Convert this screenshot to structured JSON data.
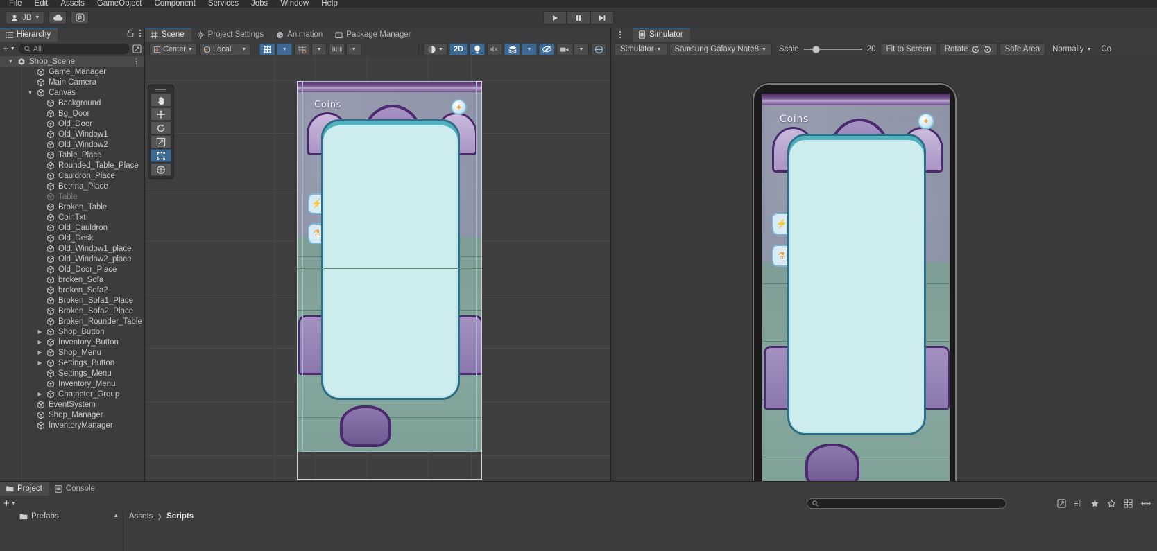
{
  "menubar": {
    "items": [
      "File",
      "Edit",
      "Assets",
      "GameObject",
      "Component",
      "Services",
      "Jobs",
      "Window",
      "Help"
    ]
  },
  "toolbar": {
    "account_label": "JB",
    "cloud_icon": "cloud-icon",
    "collab_icon": "collab-icon",
    "play_icon": "play-icon",
    "pause_icon": "pause-icon",
    "step_icon": "step-icon"
  },
  "hierarchy": {
    "tab_label": "Hierarchy",
    "lock_icon": "lock-icon",
    "menu_icon": "kebab-menu-icon",
    "add_label": "+",
    "search_placeholder": "All",
    "search_icon": "search-icon",
    "filter_icon": "filter-icon",
    "items": [
      {
        "label": "Shop_Scene",
        "depth": 0,
        "arrow": "down",
        "icon": "unity-scene-icon",
        "selected": true,
        "dim": false,
        "kebab": true
      },
      {
        "label": "Game_Manager",
        "depth": 2,
        "arrow": "",
        "icon": "gameobject-icon",
        "selected": false,
        "dim": false,
        "kebab": false
      },
      {
        "label": "Main Camera",
        "depth": 2,
        "arrow": "",
        "icon": "gameobject-icon",
        "selected": false,
        "dim": false,
        "kebab": false
      },
      {
        "label": "Canvas",
        "depth": 2,
        "arrow": "down",
        "icon": "gameobject-icon",
        "selected": false,
        "dim": false,
        "kebab": false
      },
      {
        "label": "Background",
        "depth": 3,
        "arrow": "",
        "icon": "gameobject-icon",
        "selected": false,
        "dim": false,
        "kebab": false
      },
      {
        "label": "Bg_Door",
        "depth": 3,
        "arrow": "",
        "icon": "gameobject-icon",
        "selected": false,
        "dim": false,
        "kebab": false
      },
      {
        "label": "Old_Door",
        "depth": 3,
        "arrow": "",
        "icon": "gameobject-icon",
        "selected": false,
        "dim": false,
        "kebab": false
      },
      {
        "label": "Old_Window1",
        "depth": 3,
        "arrow": "",
        "icon": "gameobject-icon",
        "selected": false,
        "dim": false,
        "kebab": false
      },
      {
        "label": "Old_Window2",
        "depth": 3,
        "arrow": "",
        "icon": "gameobject-icon",
        "selected": false,
        "dim": false,
        "kebab": false
      },
      {
        "label": "Table_Place",
        "depth": 3,
        "arrow": "",
        "icon": "gameobject-icon",
        "selected": false,
        "dim": false,
        "kebab": false
      },
      {
        "label": "Rounded_Table_Place",
        "depth": 3,
        "arrow": "",
        "icon": "gameobject-icon",
        "selected": false,
        "dim": false,
        "kebab": false
      },
      {
        "label": "Cauldron_Place",
        "depth": 3,
        "arrow": "",
        "icon": "gameobject-icon",
        "selected": false,
        "dim": false,
        "kebab": false
      },
      {
        "label": "Betrina_Place",
        "depth": 3,
        "arrow": "",
        "icon": "gameobject-icon",
        "selected": false,
        "dim": false,
        "kebab": false
      },
      {
        "label": "Table",
        "depth": 3,
        "arrow": "",
        "icon": "gameobject-icon",
        "selected": false,
        "dim": true,
        "kebab": false
      },
      {
        "label": "Broken_Table",
        "depth": 3,
        "arrow": "",
        "icon": "gameobject-icon",
        "selected": false,
        "dim": false,
        "kebab": false
      },
      {
        "label": "CoinTxt",
        "depth": 3,
        "arrow": "",
        "icon": "gameobject-icon",
        "selected": false,
        "dim": false,
        "kebab": false
      },
      {
        "label": "Old_Cauldron",
        "depth": 3,
        "arrow": "",
        "icon": "gameobject-icon",
        "selected": false,
        "dim": false,
        "kebab": false
      },
      {
        "label": "Old_Desk",
        "depth": 3,
        "arrow": "",
        "icon": "gameobject-icon",
        "selected": false,
        "dim": false,
        "kebab": false
      },
      {
        "label": "Old_Window1_place",
        "depth": 3,
        "arrow": "",
        "icon": "gameobject-icon",
        "selected": false,
        "dim": false,
        "kebab": false
      },
      {
        "label": "Old_Window2_place",
        "depth": 3,
        "arrow": "",
        "icon": "gameobject-icon",
        "selected": false,
        "dim": false,
        "kebab": false
      },
      {
        "label": "Old_Door_Place",
        "depth": 3,
        "arrow": "",
        "icon": "gameobject-icon",
        "selected": false,
        "dim": false,
        "kebab": false
      },
      {
        "label": "broken_Sofa",
        "depth": 3,
        "arrow": "",
        "icon": "gameobject-icon",
        "selected": false,
        "dim": false,
        "kebab": false
      },
      {
        "label": "broken_Sofa2",
        "depth": 3,
        "arrow": "",
        "icon": "gameobject-icon",
        "selected": false,
        "dim": false,
        "kebab": false
      },
      {
        "label": "Broken_Sofa1_Place",
        "depth": 3,
        "arrow": "",
        "icon": "gameobject-icon",
        "selected": false,
        "dim": false,
        "kebab": false
      },
      {
        "label": "Broken_Sofa2_Place",
        "depth": 3,
        "arrow": "",
        "icon": "gameobject-icon",
        "selected": false,
        "dim": false,
        "kebab": false
      },
      {
        "label": "Broken_Rounder_Table",
        "depth": 3,
        "arrow": "",
        "icon": "gameobject-icon",
        "selected": false,
        "dim": false,
        "kebab": false
      },
      {
        "label": "Shop_Button",
        "depth": 3,
        "arrow": "right",
        "icon": "gameobject-icon",
        "selected": false,
        "dim": false,
        "kebab": false
      },
      {
        "label": "Inventory_Button",
        "depth": 3,
        "arrow": "right",
        "icon": "gameobject-icon",
        "selected": false,
        "dim": false,
        "kebab": false
      },
      {
        "label": "Shop_Menu",
        "depth": 3,
        "arrow": "right",
        "icon": "gameobject-icon",
        "selected": false,
        "dim": false,
        "kebab": false
      },
      {
        "label": "Settings_Button",
        "depth": 3,
        "arrow": "right",
        "icon": "gameobject-icon",
        "selected": false,
        "dim": false,
        "kebab": false
      },
      {
        "label": "Settings_Menu",
        "depth": 3,
        "arrow": "",
        "icon": "gameobject-icon",
        "selected": false,
        "dim": false,
        "kebab": false
      },
      {
        "label": "Inventory_Menu",
        "depth": 3,
        "arrow": "",
        "icon": "gameobject-icon",
        "selected": false,
        "dim": false,
        "kebab": false
      },
      {
        "label": "Chatacter_Group",
        "depth": 3,
        "arrow": "right",
        "icon": "gameobject-icon",
        "selected": false,
        "dim": false,
        "kebab": false
      },
      {
        "label": "EventSystem",
        "depth": 2,
        "arrow": "",
        "icon": "gameobject-icon",
        "selected": false,
        "dim": false,
        "kebab": false
      },
      {
        "label": "Shop_Manager",
        "depth": 2,
        "arrow": "",
        "icon": "gameobject-icon",
        "selected": false,
        "dim": false,
        "kebab": false
      },
      {
        "label": "InventoryManager",
        "depth": 2,
        "arrow": "",
        "icon": "gameobject-icon",
        "selected": false,
        "dim": false,
        "kebab": false
      }
    ]
  },
  "scene": {
    "tabs": [
      {
        "label": "Scene",
        "icon": "grid-icon",
        "active": true
      },
      {
        "label": "Project Settings",
        "icon": "gear-icon",
        "active": false
      },
      {
        "label": "Animation",
        "icon": "clock-icon",
        "active": false
      },
      {
        "label": "Package Manager",
        "icon": "package-icon",
        "active": false
      }
    ],
    "menu_icon": "kebab-menu-icon",
    "toolbar": {
      "pivot_label": "Center",
      "pivot_icon": "pivot-icon",
      "space_label": "Local",
      "space_icon": "cube-icon",
      "grid_icon": "grid-snap-icon",
      "snap_icon": "snap-increment-icon",
      "ruler_icon": "ruler-icon",
      "draw_mode_icon": "shaded-sphere-icon",
      "mode_2d_label": "2D",
      "light_icon": "lighting-icon",
      "audio_icon": "audio-mute-icon",
      "fx_icon": "effects-icon",
      "hidden_icon": "hidden-objects-icon",
      "camera_icon": "scene-camera-icon"
    },
    "tools": [
      {
        "name": "hand-tool",
        "active": false
      },
      {
        "name": "move-tool",
        "active": false
      },
      {
        "name": "rotate-tool",
        "active": false
      },
      {
        "name": "scale-tool",
        "active": false
      },
      {
        "name": "rect-tool",
        "active": true
      },
      {
        "name": "transform-tool",
        "active": false
      }
    ]
  },
  "game_art": {
    "coins_label": "Coins",
    "coin_icon": "coin-flower-icon",
    "left_button_1_icon": "lightning-icon",
    "left_button_2_icon": "potion-icon"
  },
  "simulator": {
    "tab_label": "Simulator",
    "tab_icon": "device-icon",
    "menu_icon": "kebab-menu-icon",
    "mode_label": "Simulator",
    "device_label": "Samsung Galaxy Note8",
    "scale_label": "Scale",
    "scale_value": "20",
    "fit_label": "Fit to Screen",
    "rotate_label": "Rotate",
    "rotate_ccw_icon": "rotate-ccw-icon",
    "rotate_cw_icon": "rotate-cw-icon",
    "safe_area_label": "Safe Area",
    "resolution_label": "Normally",
    "overflow_label": "Co"
  },
  "bottom": {
    "tabs": [
      {
        "label": "Project",
        "icon": "folder-icon",
        "active": true
      },
      {
        "label": "Console",
        "icon": "console-icon",
        "active": false
      }
    ],
    "add_label": "+",
    "search_placeholder": "",
    "search_icon": "search-icon",
    "icons": [
      "packages-icon",
      "layers-icon",
      "favorite-icon",
      "star-icon",
      "grid-view-icon",
      "slider-icon"
    ],
    "folder_label": "Prefabs",
    "folder_icon": "folder-icon",
    "sort_icon": "sort-arrow-icon",
    "breadcrumb": [
      "Assets",
      "Scripts"
    ]
  }
}
